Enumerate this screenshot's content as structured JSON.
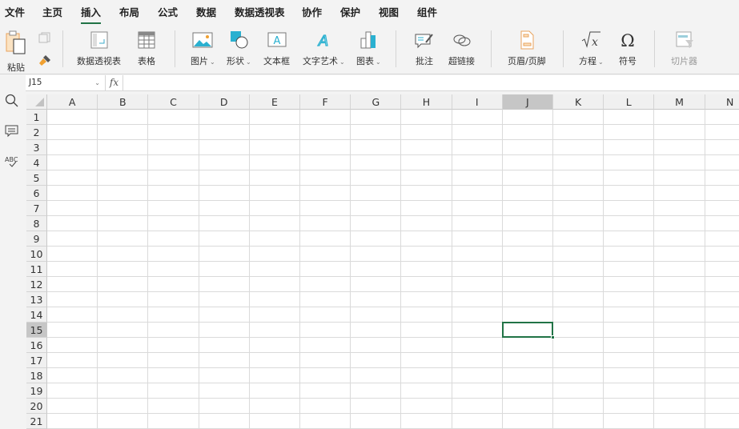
{
  "menu": [
    "文件",
    "主页",
    "插入",
    "布局",
    "公式",
    "数据",
    "数据透视表",
    "协作",
    "保护",
    "视图",
    "组件"
  ],
  "active_menu": "插入",
  "ribbon": {
    "paste": "粘贴",
    "pivot": "数据透视表",
    "table": "表格",
    "picture": "图片",
    "shape": "形状",
    "textbox": "文本框",
    "wordart": "文字艺术",
    "chart": "图表",
    "comment": "批注",
    "hyperlink": "超链接",
    "header_footer": "页眉/页脚",
    "equation": "方程",
    "symbol": "符号",
    "slicer": "切片器",
    "dropdown_glyph": "⌄"
  },
  "formula_bar": {
    "name_box": "J15",
    "fx": "fx",
    "value": ""
  },
  "columns": [
    "A",
    "B",
    "C",
    "D",
    "E",
    "F",
    "G",
    "H",
    "I",
    "J",
    "K",
    "L",
    "M",
    "N"
  ],
  "rows": [
    1,
    2,
    3,
    4,
    5,
    6,
    7,
    8,
    9,
    10,
    11,
    12,
    13,
    14,
    15,
    16,
    17,
    18,
    19,
    20,
    21
  ],
  "selection": {
    "col": "J",
    "row": 15
  },
  "colors": {
    "accent": "#217346"
  }
}
